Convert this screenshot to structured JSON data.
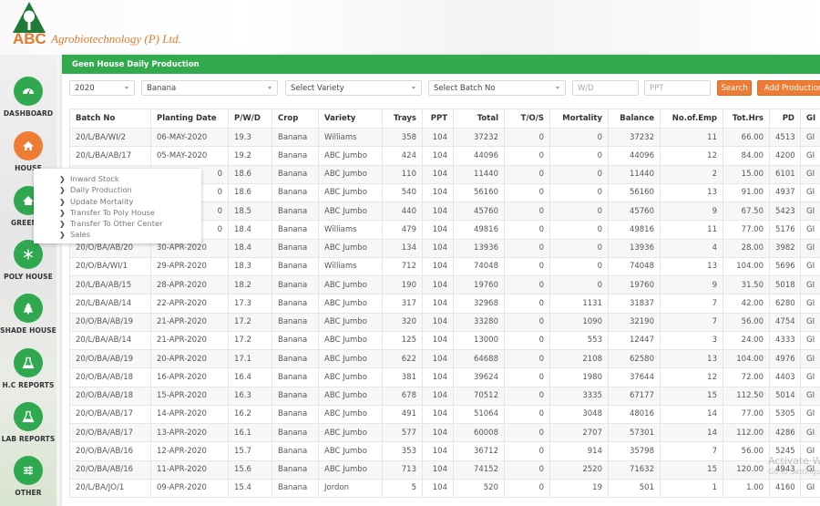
{
  "brand": {
    "abc": "ABC",
    "name": "Agrobiotechnology (P) Ltd.",
    "colors": {
      "green": "#2fa84f",
      "orange": "#ee7c34",
      "header_green": "#32ab4c"
    }
  },
  "sidebar": {
    "items": [
      {
        "label": "DASHBOARD",
        "icon": "dashboard-gauge-icon",
        "active": false
      },
      {
        "label": "HOUSE",
        "icon": "house-icon",
        "active": true
      },
      {
        "label": "GREEN H",
        "icon": "greenhouse-icon",
        "active": false
      },
      {
        "label": "POLY HOUSE",
        "icon": "snowflake-icon",
        "active": false
      },
      {
        "label": "SHADE HOUSE",
        "icon": "tree-icon",
        "active": false
      },
      {
        "label": "H.C REPORTS",
        "icon": "flask-icon",
        "active": false
      },
      {
        "label": "LAB REPORTS",
        "icon": "flask-icon",
        "active": false
      },
      {
        "label": "OTHER",
        "icon": "sliders-icon",
        "active": false
      }
    ]
  },
  "submenu": {
    "items": [
      "Inward Stock",
      "Daily Production",
      "Update Mortality",
      "Transfer To Poly House",
      "Transfer To Other Center",
      "Sales"
    ]
  },
  "panel": {
    "title": "Geen House Daily Production",
    "filters": {
      "year": "2020",
      "crop": "Banana",
      "variety_placeholder": "Select Variety",
      "batch_placeholder": "Select Batch No",
      "wd_placeholder": "W/D",
      "ppt_placeholder": "PPT",
      "search_label": "Search",
      "add_label": "Add Production"
    }
  },
  "table": {
    "headers": [
      "Batch No",
      "Planting Date",
      "P/W/D",
      "Crop",
      "Variety",
      "Trays",
      "PPT",
      "Total",
      "T/O/S",
      "Mortality",
      "Balance",
      "No.of.Emp",
      "Tot.Hrs",
      "PD",
      "GI"
    ],
    "rows": [
      [
        "20/L/BA/WI/2",
        "06-MAY-2020",
        "19.3",
        "Banana",
        "Williams",
        "358",
        "104",
        "37232",
        "0",
        "0",
        "37232",
        "11",
        "66.00",
        "4513",
        "GI"
      ],
      [
        "20/L/BA/AB/17",
        "05-MAY-2020",
        "19.2",
        "Banana",
        "ABC Jumbo",
        "424",
        "104",
        "44096",
        "0",
        "0",
        "44096",
        "12",
        "84.00",
        "4200",
        "GI"
      ],
      [
        "",
        "0",
        "18.6",
        "Banana",
        "ABC Jumbo",
        "110",
        "104",
        "11440",
        "0",
        "0",
        "11440",
        "2",
        "15.00",
        "6101",
        "GI"
      ],
      [
        "",
        "0",
        "18.6",
        "Banana",
        "ABC Jumbo",
        "540",
        "104",
        "56160",
        "0",
        "0",
        "56160",
        "13",
        "91.00",
        "4937",
        "GI"
      ],
      [
        "",
        "0",
        "18.5",
        "Banana",
        "ABC Jumbo",
        "440",
        "104",
        "45760",
        "0",
        "0",
        "45760",
        "9",
        "67.50",
        "5423",
        "GI"
      ],
      [
        "",
        "0",
        "18.4",
        "Banana",
        "Williams",
        "479",
        "104",
        "49816",
        "0",
        "0",
        "49816",
        "11",
        "77.00",
        "5176",
        "GI"
      ],
      [
        "20/O/BA/AB/20",
        "30-APR-2020",
        "18.4",
        "Banana",
        "ABC Jumbo",
        "134",
        "104",
        "13936",
        "0",
        "0",
        "13936",
        "4",
        "28.00",
        "3982",
        "GI"
      ],
      [
        "20/O/BA/WI/1",
        "29-APR-2020",
        "18.3",
        "Banana",
        "Williams",
        "712",
        "104",
        "74048",
        "0",
        "0",
        "74048",
        "13",
        "104.00",
        "5696",
        "GI"
      ],
      [
        "20/L/BA/AB/15",
        "28-APR-2020",
        "18.2",
        "Banana",
        "ABC Jumbo",
        "190",
        "104",
        "19760",
        "0",
        "0",
        "19760",
        "9",
        "31.50",
        "5018",
        "GI"
      ],
      [
        "20/L/BA/AB/14",
        "22-APR-2020",
        "17.3",
        "Banana",
        "ABC Jumbo",
        "317",
        "104",
        "32968",
        "0",
        "1131",
        "31837",
        "7",
        "42.00",
        "6280",
        "GI"
      ],
      [
        "20/O/BA/AB/19",
        "21-APR-2020",
        "17.2",
        "Banana",
        "ABC Jumbo",
        "320",
        "104",
        "33280",
        "0",
        "1090",
        "32190",
        "7",
        "56.00",
        "4754",
        "GI"
      ],
      [
        "20/L/BA/AB/14",
        "21-APR-2020",
        "17.2",
        "Banana",
        "ABC Jumbo",
        "125",
        "104",
        "13000",
        "0",
        "553",
        "12447",
        "3",
        "24.00",
        "4333",
        "GI"
      ],
      [
        "20/O/BA/AB/19",
        "20-APR-2020",
        "17.1",
        "Banana",
        "ABC Jumbo",
        "622",
        "104",
        "64688",
        "0",
        "2108",
        "62580",
        "13",
        "104.00",
        "4976",
        "GI"
      ],
      [
        "20/O/BA/AB/18",
        "16-APR-2020",
        "16.4",
        "Banana",
        "ABC Jumbo",
        "381",
        "104",
        "39624",
        "0",
        "1980",
        "37644",
        "12",
        "72.00",
        "4403",
        "GI"
      ],
      [
        "20/O/BA/AB/18",
        "15-APR-2020",
        "16.3",
        "Banana",
        "ABC Jumbo",
        "678",
        "104",
        "70512",
        "0",
        "3335",
        "67177",
        "15",
        "112.50",
        "5014",
        "GI"
      ],
      [
        "20/O/BA/AB/17",
        "14-APR-2020",
        "16.2",
        "Banana",
        "ABC Jumbo",
        "491",
        "104",
        "51064",
        "0",
        "3048",
        "48016",
        "14",
        "77.00",
        "5305",
        "GI"
      ],
      [
        "20/O/BA/AB/17",
        "13-APR-2020",
        "16.1",
        "Banana",
        "ABC Jumbo",
        "577",
        "104",
        "60008",
        "0",
        "2707",
        "57301",
        "14",
        "112.00",
        "4286",
        "GI"
      ],
      [
        "20/O/BA/AB/16",
        "12-APR-2020",
        "15.7",
        "Banana",
        "ABC Jumbo",
        "353",
        "104",
        "36712",
        "0",
        "914",
        "35798",
        "7",
        "56.00",
        "5245",
        "GI"
      ],
      [
        "20/O/BA/AB/16",
        "11-APR-2020",
        "15.6",
        "Banana",
        "ABC Jumbo",
        "713",
        "104",
        "74152",
        "0",
        "2520",
        "71632",
        "15",
        "120.00",
        "4943",
        "GI"
      ],
      [
        "20/L/BA/JO/1",
        "09-APR-2020",
        "15.4",
        "Banana",
        "Jordon",
        "5",
        "104",
        "520",
        "0",
        "19",
        "501",
        "1",
        "1.00",
        "4160",
        "GI"
      ]
    ]
  },
  "watermark": {
    "line1": "Activate W",
    "line2": "Go to Settings"
  }
}
